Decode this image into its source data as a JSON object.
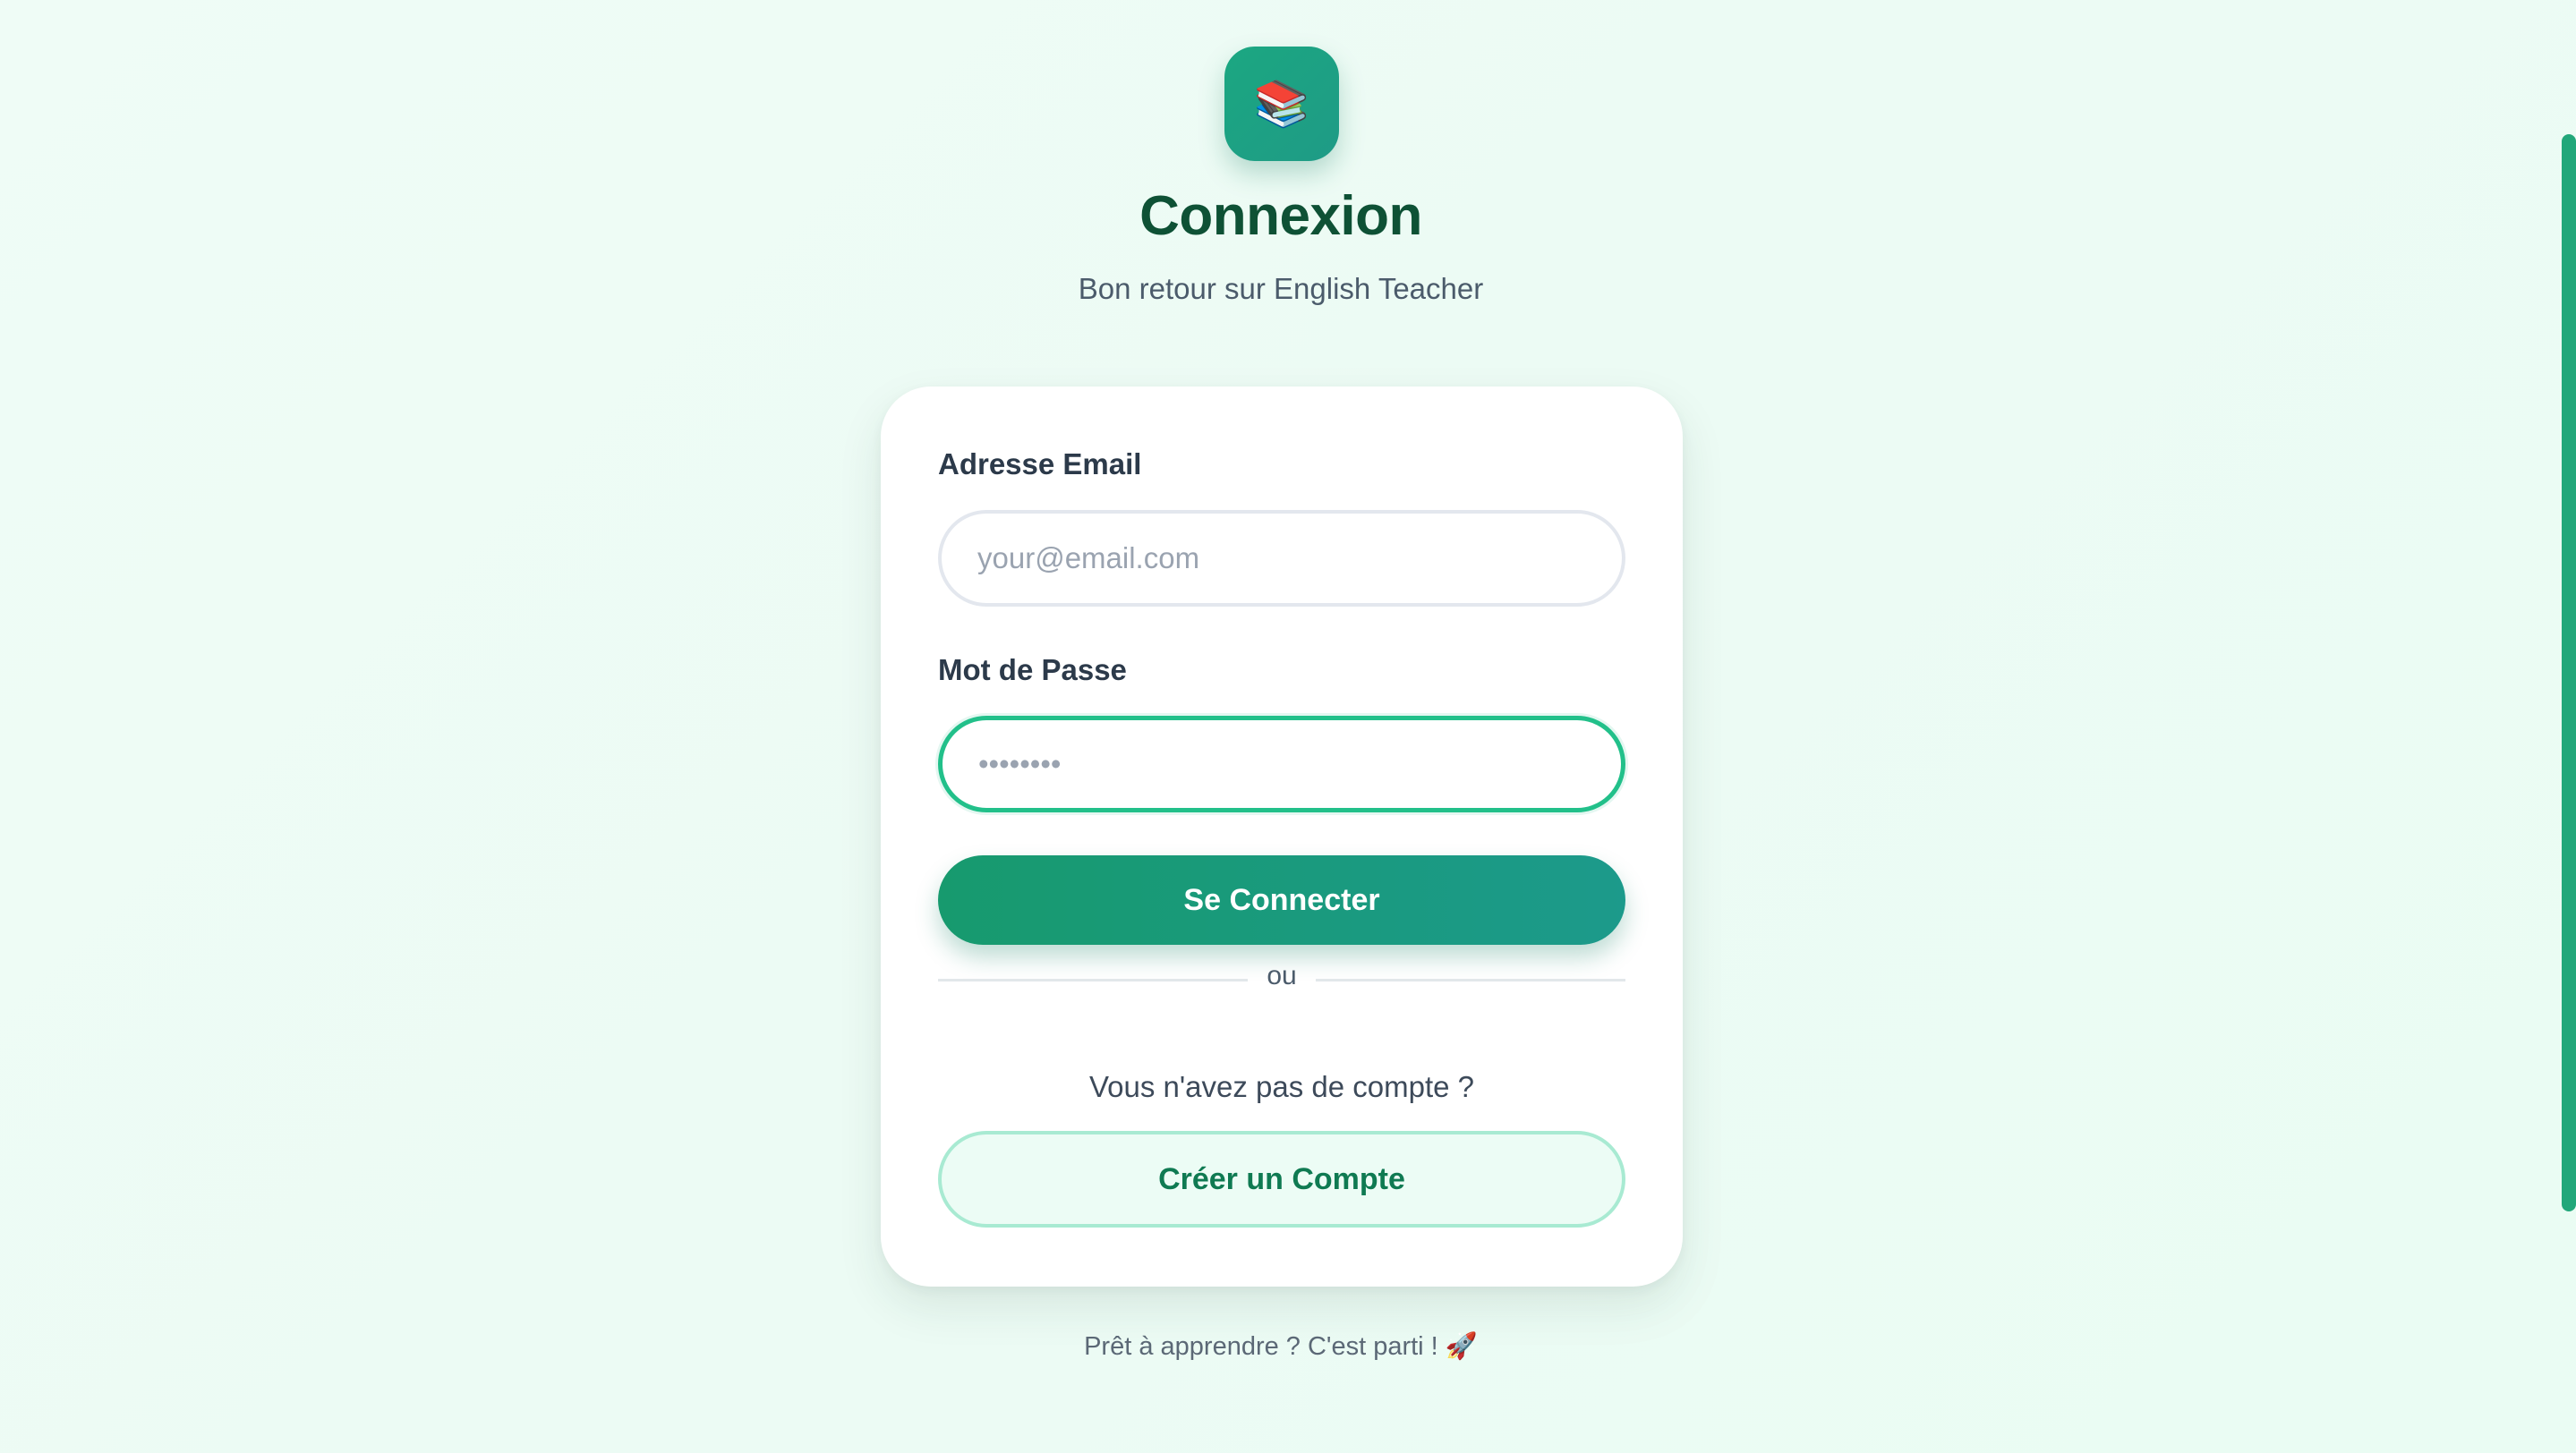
{
  "header": {
    "logo_emoji": "📚",
    "title": "Connexion",
    "subtitle": "Bon retour sur English Teacher"
  },
  "form": {
    "email": {
      "label": "Adresse Email",
      "placeholder": "your@email.com",
      "value": ""
    },
    "password": {
      "label": "Mot de Passe",
      "placeholder": "••••••••",
      "value": ""
    },
    "submit_label": "Se Connecter",
    "divider_text": "ou",
    "no_account_text": "Vous n'avez pas de compte ?",
    "create_account_label": "Créer un Compte"
  },
  "footer": {
    "text": "Prêt à apprendre ? C'est parti ! 🚀"
  },
  "colors": {
    "accent": "#179a6e",
    "title": "#0e5135",
    "focus_border": "#22c08a",
    "secondary_bg": "#ecfcf5"
  }
}
